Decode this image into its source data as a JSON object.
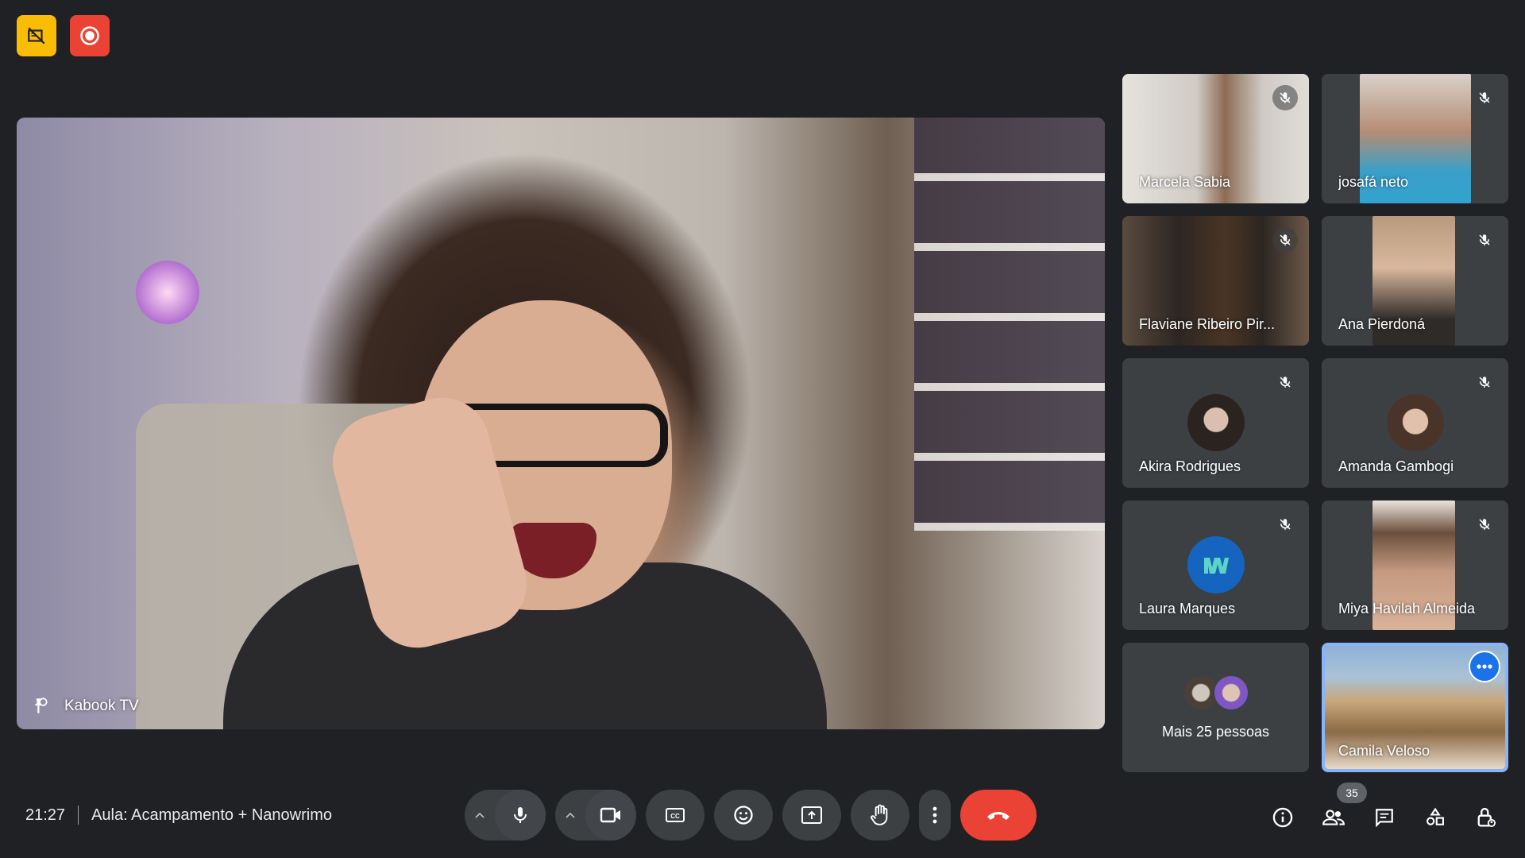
{
  "main": {
    "speaker_name": "Kabook TV"
  },
  "participants": [
    {
      "name": "Marcela Sabia",
      "video": true,
      "muted": true
    },
    {
      "name": "josafá neto",
      "video": true,
      "muted": true
    },
    {
      "name": "Flaviane Ribeiro Pir...",
      "video": true,
      "muted": true
    },
    {
      "name": "Ana Pierdoná",
      "video": true,
      "muted": true
    },
    {
      "name": "Akira Rodrigues",
      "video": false,
      "muted": true
    },
    {
      "name": "Amanda Gambogi",
      "video": false,
      "muted": true
    },
    {
      "name": "Laura Marques",
      "video": false,
      "muted": true
    },
    {
      "name": "Miya Havilah Almeida",
      "video": true,
      "muted": true
    }
  ],
  "more_tile": {
    "label": "Mais 25 pessoas"
  },
  "self_tile": {
    "name": "Camila Veloso"
  },
  "bottom_bar": {
    "time": "21:27",
    "meeting_title": "Aula: Acampamento + Nanowrimo",
    "participant_count": "35"
  },
  "colors": {
    "background": "#202124",
    "tile": "#3c4043",
    "end_call": "#ea4335",
    "recording": "#ea4335",
    "warning": "#fbbc04",
    "accent": "#1a73e8",
    "highlight": "#8ab4f8"
  },
  "icons": {
    "top_left": [
      "no-video-badge-icon",
      "recording-icon"
    ],
    "controls": [
      "mic-options-caret-icon",
      "mic-icon",
      "camera-options-caret-icon",
      "camera-icon",
      "captions-icon",
      "emoji-icon",
      "present-icon",
      "raise-hand-icon",
      "more-options-icon",
      "end-call-icon"
    ],
    "right": [
      "info-icon",
      "people-icon",
      "chat-icon",
      "activities-icon",
      "host-controls-icon"
    ]
  }
}
